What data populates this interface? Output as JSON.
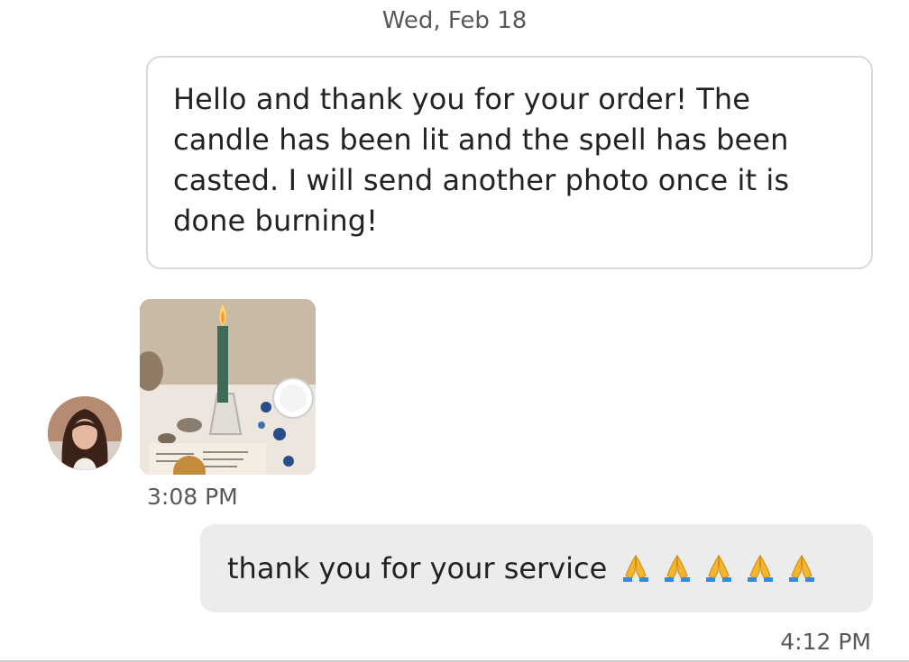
{
  "conversation": {
    "date_divider": "Wed, Feb 18",
    "messages": [
      {
        "direction": "incoming",
        "text": "Hello and thank you for your order! The candle has been lit and the spell has been casted. I will send another photo once it is done burning!"
      },
      {
        "direction": "incoming",
        "type": "photo",
        "time": "3:08 PM",
        "image_icon": "candle-photo"
      },
      {
        "direction": "outgoing",
        "text": "thank you for your service",
        "emoji": [
          "🙏",
          "🙏",
          "🙏",
          "🙏",
          "🙏"
        ],
        "emoji_icon": "folded-hands-icon",
        "time": "4:12 PM"
      }
    ]
  },
  "colors": {
    "outgoing_bubble": "#ececec",
    "incoming_border": "#d9d9d9",
    "muted_text": "#595959",
    "text": "#222222",
    "emoji_yellow": "#f6b52a",
    "emoji_blue": "#3a8ad6"
  }
}
